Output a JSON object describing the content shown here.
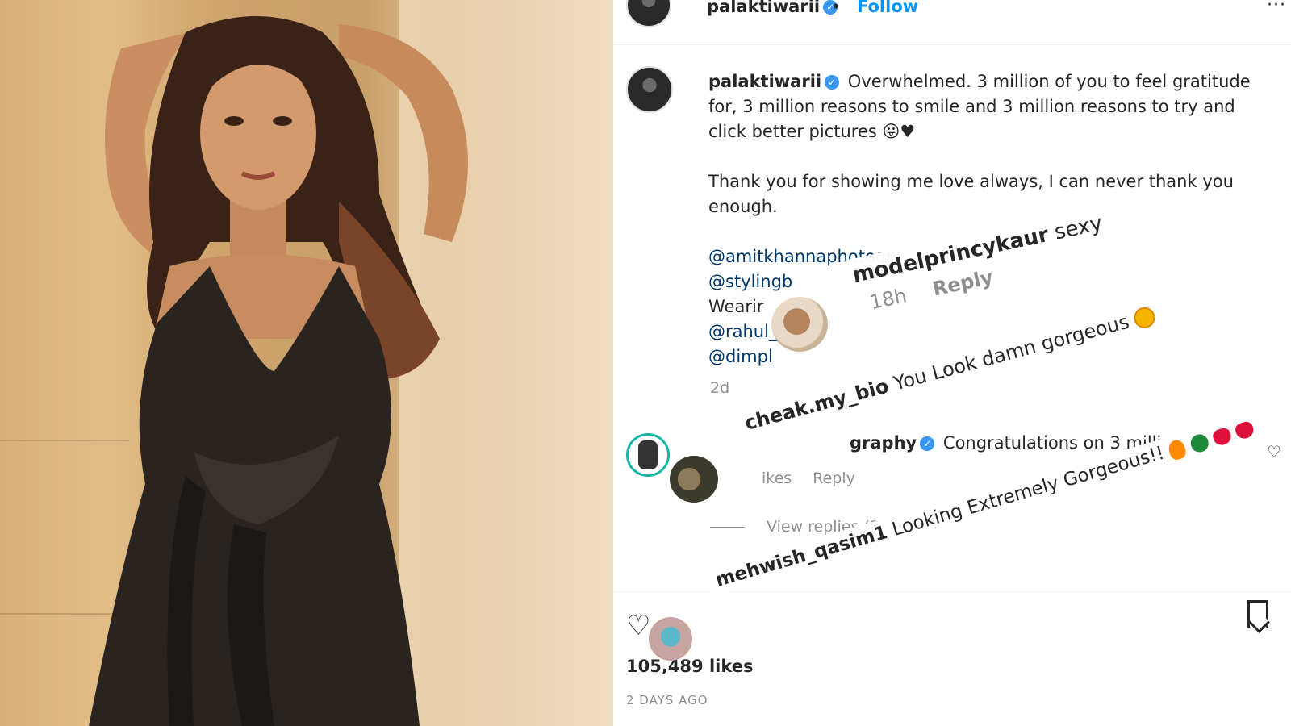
{
  "post": {
    "username": "palaktiwarii",
    "follow_label": "Follow",
    "more_label": "···",
    "caption_line1": "Overwhelmed. 3 million of you to feel gratitude for, 3 million reasons to smile and 3 million reasons to try and click better pictures",
    "caption_emoji": "😛♥",
    "caption_line2": "Thank you for showing me love always, I can never thank you enough.",
    "tags": [
      "@amitkhannaphotogr",
      "@stylingb",
      "Wearir",
      "@rahul_",
      "@dimpl"
    ],
    "time_ago": "2d",
    "likes": "105,489 likes",
    "posted": "2 DAYS AGO"
  },
  "comments": [
    {
      "username": "graphy",
      "text": "Congratulations on 3 milli",
      "likes": "ikes",
      "reply_label": "Reply",
      "view_replies": "View replies (3)"
    }
  ],
  "overlays": [
    {
      "username": "modelprincykaur",
      "text": "sexy",
      "time": "18h",
      "reply_label": "Reply"
    },
    {
      "username": "cheak.my_bio",
      "text": "You Look damn gorgeous"
    },
    {
      "username": "mehwish_qasim1",
      "text": "Looking Extremely Gorgeous!!"
    }
  ],
  "colors": {
    "accent": "#0095f6",
    "verified": "#3897f0",
    "muted": "#8e8e8e",
    "tag": "#00376b"
  }
}
